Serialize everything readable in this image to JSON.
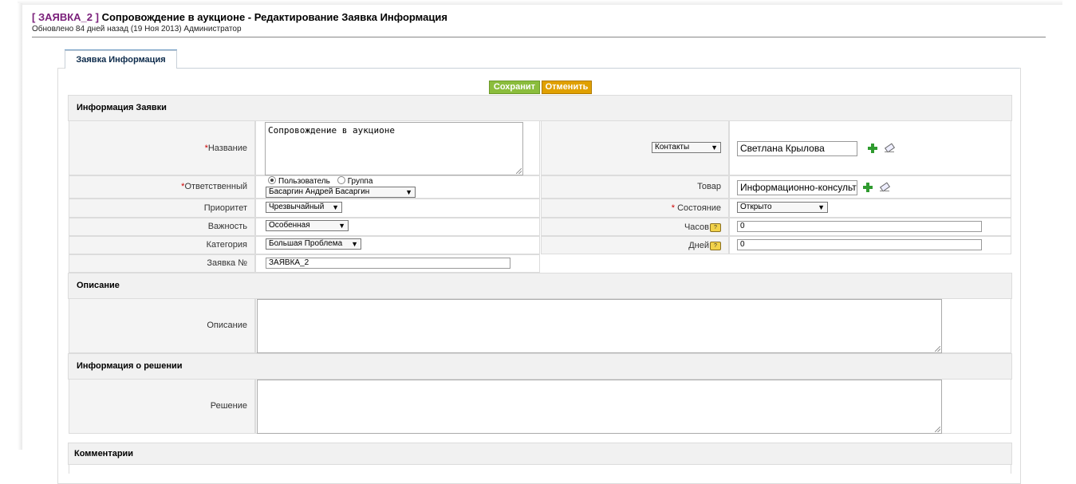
{
  "header": {
    "record_id": "[ ЗАЯВКА_2 ]",
    "title": "Сопровождение в аукционе - Редактирование Заявка Информация",
    "updated": "Обновлено 84 дней назад (19 Ноя 2013) Администратор"
  },
  "tab": {
    "label": "Заявка Информация"
  },
  "actions": {
    "save": "Сохранит",
    "cancel": "Отменить"
  },
  "sections": {
    "info": "Информация Заявки",
    "description": "Описание",
    "resolution": "Информация о решении",
    "comments": "Комментарии"
  },
  "fields": {
    "required_mark": "*",
    "name_label": "Название",
    "name_value": "Сопровождение в аукционе",
    "assigned_label": "Ответственный",
    "assigned_radio_user": "Пользователь",
    "assigned_radio_group": "Группа",
    "assigned_value": "Басаргин Андрей Басаргин",
    "priority_label": "Приоритет",
    "priority_value": "Чрезвычайный",
    "severity_label": "Важность",
    "severity_value": "Особенная",
    "category_label": "Категория",
    "category_value": "Большая Проблема",
    "ticket_no_label": "Заявка №",
    "ticket_no_value": "ЗАЯВКА_2",
    "related_type": "Контакты",
    "contact_value": "Светлана Крылова",
    "product_label": "Товар",
    "product_value": "Информационно-консульт",
    "status_label": "Состояние",
    "status_value": "Открыто",
    "hours_label": "Часов",
    "hours_value": "0",
    "days_label": "Дней",
    "days_value": "0",
    "description_label": "Описание",
    "description_value": "",
    "solution_label": "Решение",
    "solution_value": "",
    "help_glyph": "?"
  }
}
